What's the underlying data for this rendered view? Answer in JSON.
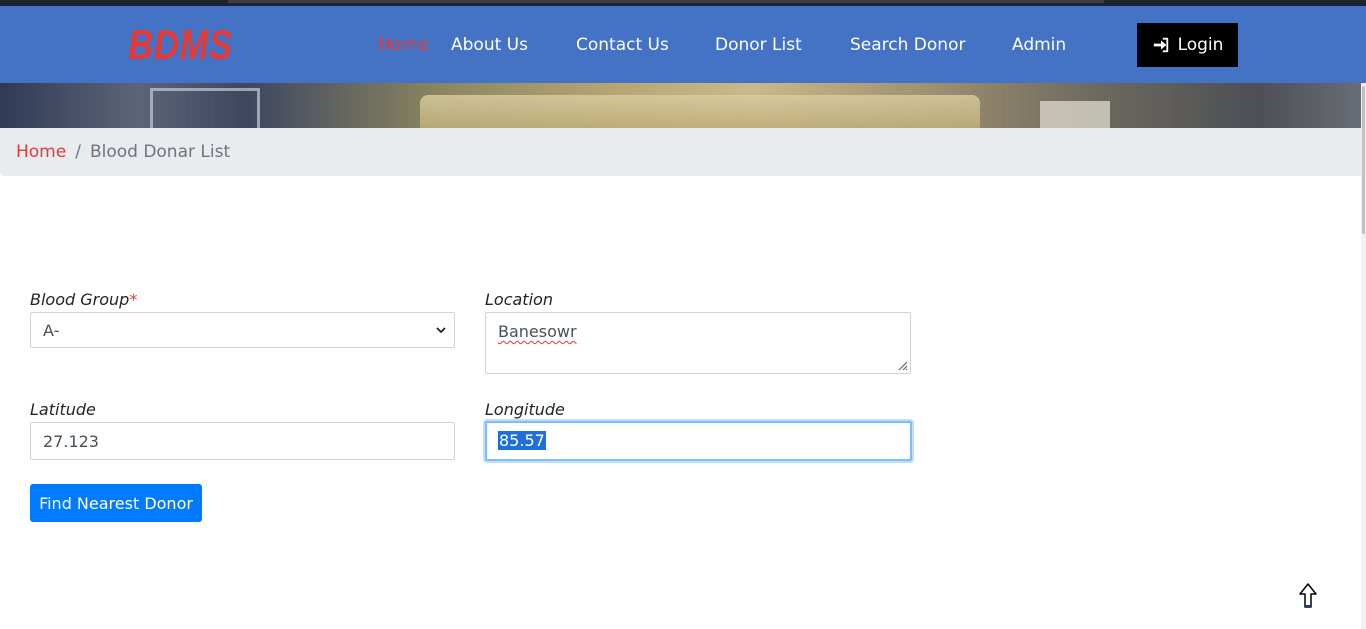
{
  "brand": "BDMS",
  "nav": {
    "items": [
      {
        "label": "Home",
        "active": true
      },
      {
        "label": "About Us",
        "active": false
      },
      {
        "label": "Contact Us",
        "active": false
      },
      {
        "label": "Donor List",
        "active": false
      },
      {
        "label": "Search Donor",
        "active": false
      },
      {
        "label": "Admin",
        "active": false
      }
    ],
    "login_label": "Login",
    "login_icon": "sign-in-icon"
  },
  "breadcrumb": {
    "home": "Home",
    "separator": "/",
    "current": "Blood Donar List"
  },
  "form": {
    "blood_group": {
      "label": "Blood Group",
      "required_mark": "*",
      "value": "A-"
    },
    "location": {
      "label": "Location",
      "value": "Banesowr"
    },
    "latitude": {
      "label": "Latitude",
      "value": "27.123"
    },
    "longitude": {
      "label": "Longitude",
      "value": "85.57"
    },
    "submit_label": "Find Nearest Donor"
  },
  "colors": {
    "navbar": "#4472c4",
    "brand": "#e53935",
    "active_link": "#e53935",
    "primary_button": "#007bff",
    "login_button": "#000000",
    "breadcrumb_bg": "#e9ecef"
  }
}
